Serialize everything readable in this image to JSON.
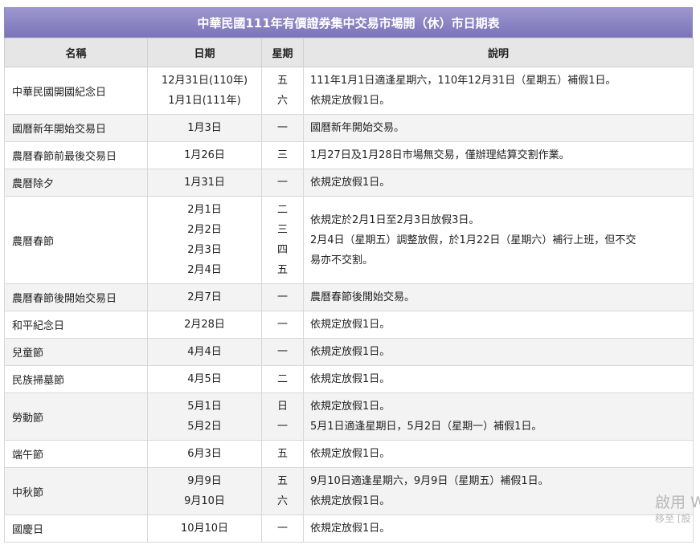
{
  "title": "中華民國111年有價證券集中交易市場開（休）市日期表",
  "headers": {
    "name": "名稱",
    "date": "日期",
    "weekday": "星期",
    "desc": "說明"
  },
  "rows": [
    {
      "name": "中華民國開國紀念日",
      "dates": [
        "12月31日(110年)",
        "1月1日(111年)"
      ],
      "weekdays": [
        "五",
        "六"
      ],
      "desc": [
        "111年1月1日適逢星期六，110年12月31日（星期五）補假1日。",
        "依規定放假1日。"
      ]
    },
    {
      "name": "國曆新年開始交易日",
      "dates": [
        "1月3日"
      ],
      "weekdays": [
        "一"
      ],
      "desc": [
        "國曆新年開始交易。"
      ]
    },
    {
      "name": "農曆春節前最後交易日",
      "dates": [
        "1月26日"
      ],
      "weekdays": [
        "三"
      ],
      "desc": [
        "1月27日及1月28日市場無交易，僅辦理結算交割作業。"
      ]
    },
    {
      "name": "農曆除夕",
      "dates": [
        "1月31日"
      ],
      "weekdays": [
        "一"
      ],
      "desc": [
        "依規定放假1日。"
      ]
    },
    {
      "name": "農曆春節",
      "dates": [
        "2月1日",
        "2月2日",
        "2月3日",
        "2月4日"
      ],
      "weekdays": [
        "二",
        "三",
        "四",
        "五"
      ],
      "desc": [
        "依規定於2月1日至2月3日放假3日。",
        "2月4日（星期五）調整放假，於1月22日（星期六）補行上班，但不交",
        "易亦不交割。"
      ]
    },
    {
      "name": "農曆春節後開始交易日",
      "dates": [
        "2月7日"
      ],
      "weekdays": [
        "一"
      ],
      "desc": [
        "農曆春節後開始交易。"
      ]
    },
    {
      "name": "和平紀念日",
      "dates": [
        "2月28日"
      ],
      "weekdays": [
        "一"
      ],
      "desc": [
        "依規定放假1日。"
      ]
    },
    {
      "name": "兒童節",
      "dates": [
        "4月4日"
      ],
      "weekdays": [
        "一"
      ],
      "desc": [
        "依規定放假1日。"
      ]
    },
    {
      "name": "民族掃墓節",
      "dates": [
        "4月5日"
      ],
      "weekdays": [
        "二"
      ],
      "desc": [
        "依規定放假1日。"
      ]
    },
    {
      "name": "勞動節",
      "dates": [
        "5月1日",
        "5月2日"
      ],
      "weekdays": [
        "日",
        "一"
      ],
      "desc": [
        "依規定放假1日。",
        "5月1日適逢星期日，5月2日（星期一）補假1日。"
      ]
    },
    {
      "name": "端午節",
      "dates": [
        "6月3日"
      ],
      "weekdays": [
        "五"
      ],
      "desc": [
        "依規定放假1日。"
      ]
    },
    {
      "name": "中秋節",
      "dates": [
        "9月9日",
        "9月10日"
      ],
      "weekdays": [
        "五",
        "六"
      ],
      "desc": [
        "9月10日適逢星期六，9月9日（星期五）補假1日。",
        "依規定放假1日。"
      ]
    },
    {
      "name": "國慶日",
      "dates": [
        "10月10日"
      ],
      "weekdays": [
        "一"
      ],
      "desc": [
        "依規定放假1日。"
      ]
    }
  ],
  "watermark": {
    "line1": "啟用 W",
    "line2": "移至 [設"
  },
  "colors": {
    "title_bg": "#8a84c2",
    "header_bg": "#e6e6e6",
    "row_alt_bg": "#f3f3f3"
  }
}
